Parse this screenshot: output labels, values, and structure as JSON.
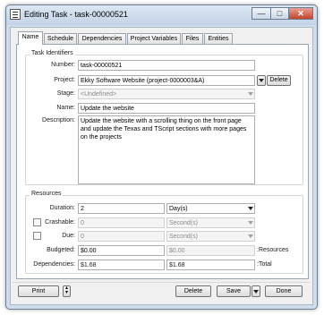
{
  "window": {
    "title": "Editing Task - task-00000521",
    "minimize_glyph": "—",
    "maximize_glyph": "□",
    "close_glyph": "✕"
  },
  "tabs": [
    {
      "label": "Name",
      "active": true
    },
    {
      "label": "Schedule",
      "active": false
    },
    {
      "label": "Dependencies",
      "active": false
    },
    {
      "label": "Project Variables",
      "active": false
    },
    {
      "label": "Files",
      "active": false
    },
    {
      "label": "Entities",
      "active": false
    }
  ],
  "task_identifiers": {
    "group_label": "Task Identifiers",
    "number_label": "Number:",
    "number_value": "task-00000521",
    "project_label": "Project:",
    "project_value": "Ekky Software Website (project-0000003&A)",
    "delete_label": "Delete",
    "stage_label": "Stage:",
    "stage_placeholder": "<Undefined>",
    "name_label": "Name:",
    "name_value": "Update the website",
    "description_label": "Description:",
    "description_value": "Update the website with a scrolling thing on the front page and update the Texas and TScript sections with more pages on the projects"
  },
  "resources": {
    "group_label": "Resources",
    "duration_label": "Duration:",
    "duration_value": "2",
    "duration_unit": "Day(s)",
    "crashable_label": "Crashable:",
    "crashable_value": "0",
    "crashable_unit": "Second(s)",
    "due_label": "Due:",
    "due_value": "0",
    "due_unit": "Second(s)",
    "budgeted_label": "Budgeted:",
    "budgeted_value": "$0.00",
    "budgeted_resources": "$0.00",
    "resources_suffix": ":Resources",
    "dependencies_label": "Dependencies:",
    "dependencies_value": "$1.68",
    "dependencies_total": "$1.68",
    "total_suffix": ":Total"
  },
  "footer": {
    "print_label": "Print",
    "delete_label": "Delete",
    "save_label": "Save",
    "done_label": "Done"
  },
  "colors": {
    "window_frame": "#cfdcec",
    "close_button": "#c4432a"
  }
}
